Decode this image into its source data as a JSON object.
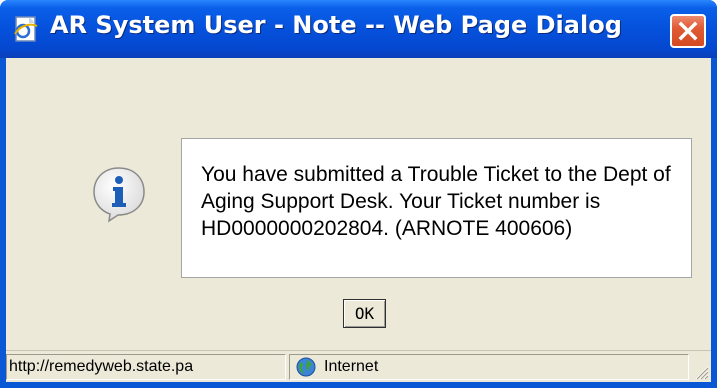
{
  "window": {
    "title": "AR System User - Note -- Web Page Dialog",
    "title_icon": "ie-page-icon",
    "close_icon": "close-icon"
  },
  "dialog": {
    "icon": "info-icon",
    "message": "You have submitted a Trouble Ticket to the Dept of Aging Support Desk. Your Ticket number is HD0000000202804. (ARNOTE 400606)",
    "ok_label": "OK"
  },
  "statusbar": {
    "url": "http://remedyweb.state.pa",
    "zone_icon": "globe-icon",
    "zone_label": "Internet"
  },
  "colors": {
    "titlebar": "#0551dc",
    "close_button": "#e05a34",
    "client_bg": "#ece9d8",
    "info_icon": "#1d5fb7"
  }
}
